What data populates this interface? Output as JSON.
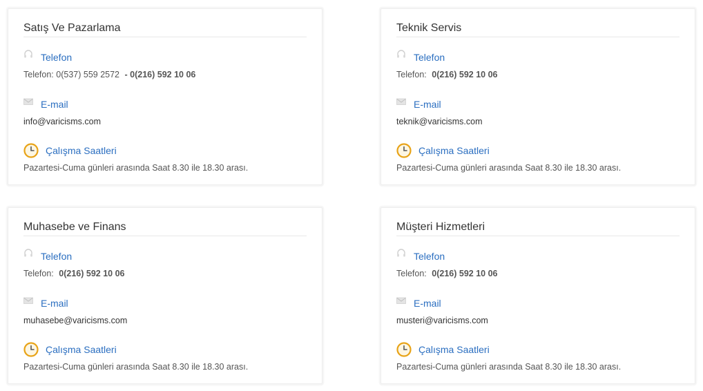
{
  "cards": [
    {
      "title": "Satış Ve Pazarlama",
      "phone_label": "Telefon",
      "phone_prefix": "Telefon:",
      "phone_primary": "0(537) 559 2572",
      "phone_secondary": "- 0(216) 592 10 06",
      "email_label": "E-mail",
      "email": "info@varicisms.com",
      "hours_label": "Çalışma Saatleri",
      "hours": "Pazartesi-Cuma günleri arasında Saat 8.30 ile 18.30 arası."
    },
    {
      "title": "Teknik Servis",
      "phone_label": "Telefon",
      "phone_prefix": "Telefon:",
      "phone_number": "0(216) 592 10 06",
      "email_label": "E-mail",
      "email": "teknik@varicisms.com",
      "hours_label": "Çalışma Saatleri",
      "hours": "Pazartesi-Cuma günleri arasında Saat 8.30 ile 18.30 arası."
    },
    {
      "title": "Muhasebe ve Finans",
      "phone_label": "Telefon",
      "phone_prefix": "Telefon:",
      "phone_number": "0(216) 592 10 06",
      "email_label": "E-mail",
      "email": "muhasebe@varicisms.com",
      "hours_label": "Çalışma Saatleri",
      "hours": "Pazartesi-Cuma günleri arasında Saat 8.30 ile 18.30 arası."
    },
    {
      "title": "Müşteri Hizmetleri",
      "phone_label": "Telefon",
      "phone_prefix": "Telefon:",
      "phone_number": "0(216) 592 10 06",
      "email_label": "E-mail",
      "email": "musteri@varicisms.com",
      "hours_label": "Çalışma Saatleri",
      "hours": "Pazartesi-Cuma günleri arasında Saat 8.30 ile 18.30 arası."
    }
  ],
  "icons": {
    "phone": "headset-icon",
    "email": "envelope-icon",
    "hours": "clock-icon"
  },
  "colors": {
    "link": "#2a6ec0",
    "text": "#555555",
    "title": "#333333",
    "clock": "#e8a317"
  }
}
